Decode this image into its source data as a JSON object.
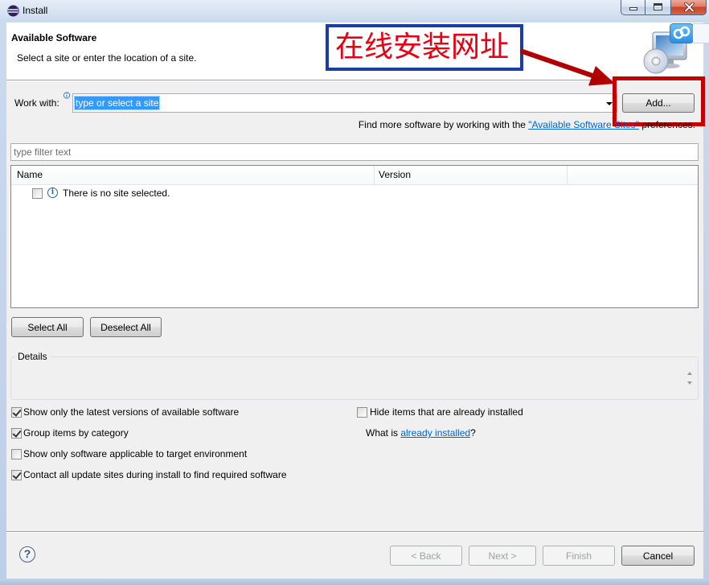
{
  "window": {
    "title": "Install",
    "icon": "eclipse-icon"
  },
  "header": {
    "title": "Available Software",
    "subtitle": "Select a site or enter the location of a site.",
    "icon": "install-software-icon"
  },
  "annotation": {
    "text": "在线安装网址"
  },
  "work_with": {
    "label": "Work with:",
    "value": "type or select a site",
    "add_button": "Add..."
  },
  "find_more": {
    "prefix": "Find more software by working with the ",
    "link": "\"Available Software Sites\"",
    "suffix": " preferences."
  },
  "filter": {
    "placeholder": "type filter text",
    "value": ""
  },
  "table": {
    "columns": [
      "Name",
      "Version"
    ],
    "rows": [
      {
        "checked": false,
        "icon": "info-icon",
        "name": "There is no site selected."
      }
    ]
  },
  "selection_buttons": {
    "select_all": "Select All",
    "deselect_all": "Deselect All"
  },
  "details": {
    "label": "Details"
  },
  "options": {
    "left": [
      {
        "label": "Show only the latest versions of available software",
        "checked": true
      },
      {
        "label": "Group items by category",
        "checked": true
      },
      {
        "label": "Show only software applicable to target environment",
        "checked": false
      },
      {
        "label": "Contact all update sites during install to find required software",
        "checked": true
      }
    ],
    "hide_installed": {
      "label": "Hide items that are already installed",
      "checked": false
    },
    "what_is": {
      "prefix": "What is ",
      "link": "already installed",
      "suffix": "?"
    }
  },
  "footer": {
    "help_glyph": "?",
    "buttons": [
      {
        "label": "< Back",
        "disabled": true
      },
      {
        "label": "Next >",
        "disabled": true
      },
      {
        "label": "Finish",
        "disabled": true
      },
      {
        "label": "Cancel",
        "disabled": false
      }
    ]
  },
  "colors": {
    "selection": "#3399ff",
    "link": "#0066cc",
    "annotation_text": "#e60012",
    "annotation_border": "#1c3ca8",
    "annotation_highlight": "#c40000",
    "disabled_text": "#a0a0a0"
  }
}
